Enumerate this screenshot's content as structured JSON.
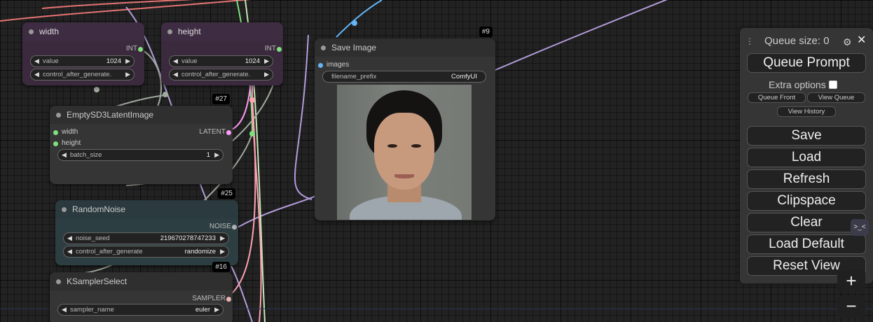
{
  "nodes": {
    "width": {
      "title": "width",
      "output": "INT",
      "widgets": [
        {
          "label": "value",
          "value": "1024"
        },
        {
          "label": "control_after_generate.",
          "value": ""
        }
      ]
    },
    "height": {
      "title": "height",
      "output": "INT",
      "widgets": [
        {
          "label": "value",
          "value": "1024"
        },
        {
          "label": "control_after_generate.",
          "value": ""
        }
      ]
    },
    "empty_latent": {
      "id": "#27",
      "title": "EmptySD3LatentImage",
      "inputs": [
        "width",
        "height"
      ],
      "output": "LATENT",
      "widgets": [
        {
          "label": "batch_size",
          "value": "1"
        }
      ]
    },
    "random_noise": {
      "id": "#25",
      "title": "RandomNoise",
      "output": "NOISE",
      "widgets": [
        {
          "label": "noise_seed",
          "value": "219670278747233"
        },
        {
          "label": "control_after_generate",
          "value": "randomize"
        }
      ]
    },
    "ksampler_select": {
      "id": "#16",
      "title": "KSamplerSelect",
      "output": "SAMPLER",
      "widgets": [
        {
          "label": "sampler_name",
          "value": "euler"
        }
      ]
    },
    "save_image": {
      "id": "#9",
      "title": "Save Image",
      "inputs": [
        "images"
      ],
      "widgets": [
        {
          "label": "filename_prefix",
          "value": "ComfyUI"
        }
      ]
    }
  },
  "queue_panel": {
    "queue_size_label": "Queue size: 0",
    "queue_prompt": "Queue Prompt",
    "extra_options": "Extra options",
    "queue_front": "Queue Front",
    "view_queue": "View Queue",
    "view_history": "View History",
    "save": "Save",
    "load": "Load",
    "refresh": "Refresh",
    "clipspace": "Clipspace",
    "clear": "Clear",
    "load_default": "Load Default",
    "reset_view": "Reset View"
  },
  "zoom": {
    "in": "+",
    "out": "−"
  },
  "side_tab_label": ">_<",
  "colors": {
    "int": "#7ee07e",
    "latent": "#ff9cf9",
    "noise": "#b0b0b0",
    "sampler": "#ecb4b4",
    "image": "#64b5f6",
    "link_purple": "#b39ddb",
    "link_red": "#e57373",
    "link_grey": "#a1aa9e"
  }
}
